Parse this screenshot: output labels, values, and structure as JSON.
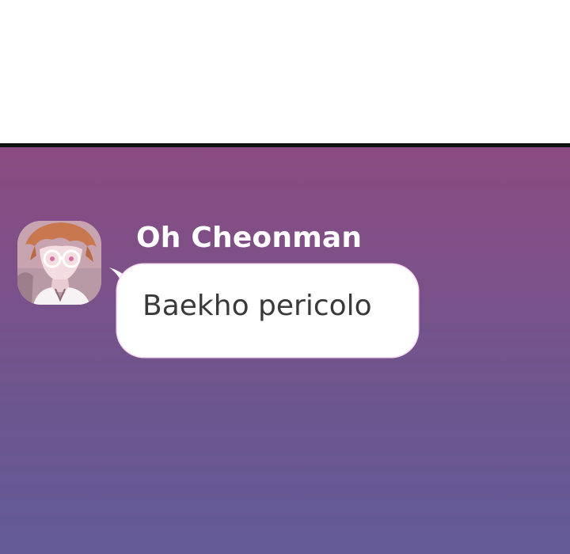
{
  "chat": {
    "sender_name": "Oh Cheonman",
    "message": "Baekho pericolo"
  },
  "colors": {
    "panel_top": "#8a4b80",
    "panel_bottom": "#635a96",
    "bubble": "#ffffff",
    "name_text": "#ffffff",
    "message_text": "#3a3a3a"
  }
}
